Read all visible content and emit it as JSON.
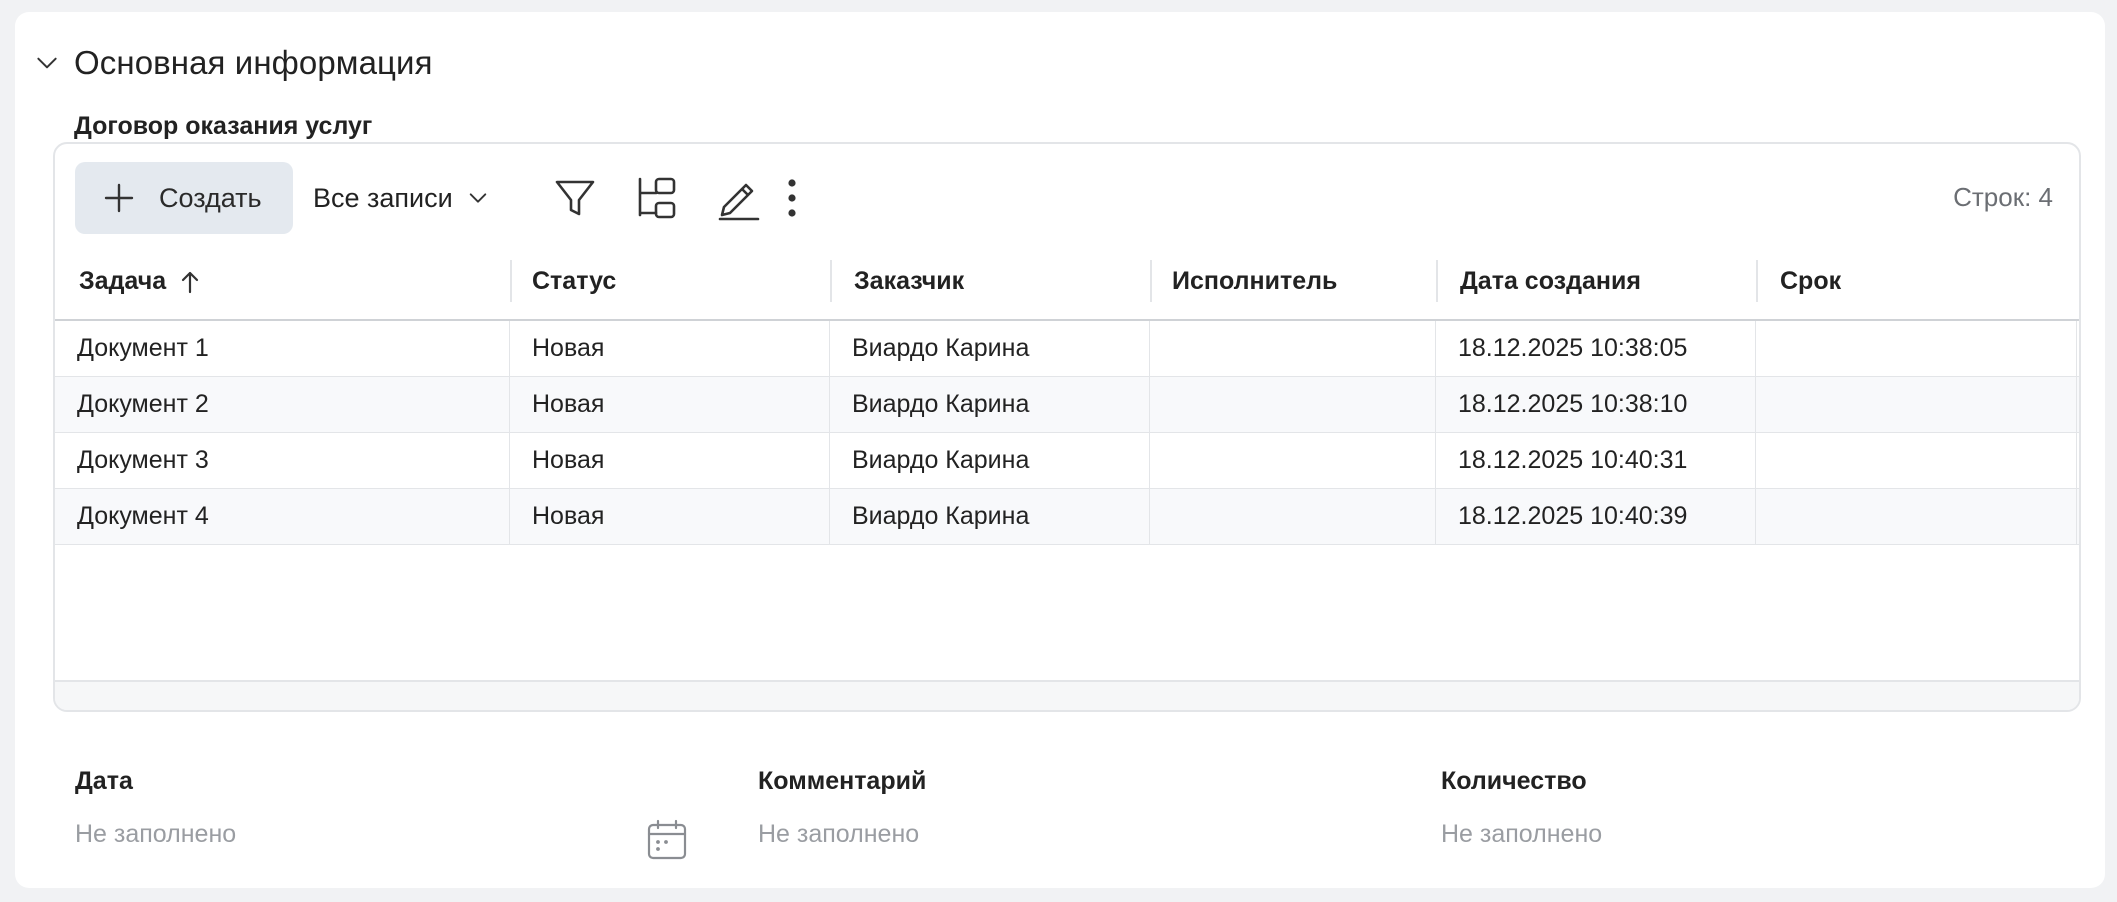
{
  "section": {
    "title": "Основная информация"
  },
  "subtable": {
    "label": "Договор оказания услуг",
    "toolbar": {
      "create_label": "Создать",
      "view_label": "Все записи",
      "rows_count": "Строк: 4"
    },
    "columns": [
      "Задача",
      "Статус",
      "Заказчик",
      "Исполнитель",
      "Дата создания",
      "Срок"
    ],
    "rows": [
      [
        "Документ 1",
        "Новая",
        "Виардо Карина",
        "",
        "18.12.2025 10:38:05",
        ""
      ],
      [
        "Документ 2",
        "Новая",
        "Виардо Карина",
        "",
        "18.12.2025 10:38:10",
        ""
      ],
      [
        "Документ 3",
        "Новая",
        "Виардо Карина",
        "",
        "18.12.2025 10:40:31",
        ""
      ],
      [
        "Документ 4",
        "Новая",
        "Виардо Карина",
        "",
        "18.12.2025 10:40:39",
        ""
      ]
    ]
  },
  "fields": {
    "date": {
      "label": "Дата",
      "value": "Не заполнено"
    },
    "comment": {
      "label": "Комментарий",
      "value": "Не заполнено"
    },
    "quantity": {
      "label": "Количество",
      "value": "Не заполнено"
    }
  },
  "icons": {
    "section_toggle": "chevron-down-icon",
    "create": "plus-icon",
    "view_dropdown": "chevron-down-icon",
    "filter": "filter-icon",
    "tree": "tree-structure-icon",
    "edit": "pencil-icon",
    "more": "more-vertical-icon",
    "sort": "arrow-up-icon",
    "date_picker": "calendar-icon"
  },
  "colors": {
    "create_button_bg": "#e4e9ef",
    "placeholder_text": "#9a9da2",
    "border": "#e3e5e8"
  }
}
